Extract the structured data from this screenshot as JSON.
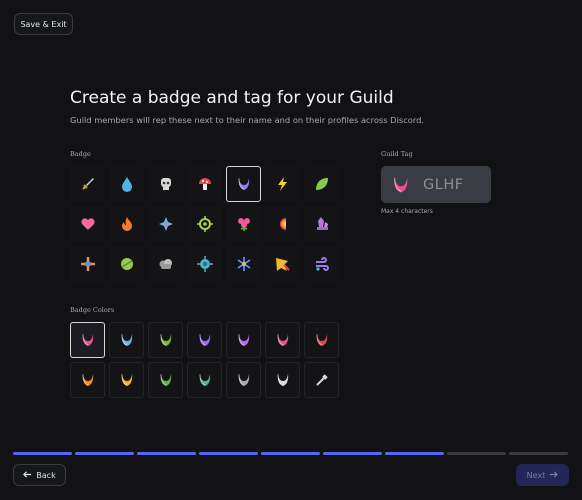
{
  "header": {
    "save_exit_label": "Save & Exit"
  },
  "title": "Create a badge and tag for your Guild",
  "subtitle": "Guild members will rep these next to their name and on their profiles across Discord.",
  "badge_section": {
    "label": "Badge",
    "items": [
      {
        "icon": "sword-icon",
        "color": "#c9a15a"
      },
      {
        "icon": "water-drop-icon",
        "color": "#4fb4e6"
      },
      {
        "icon": "skull-icon",
        "color": "#d8d8d8"
      },
      {
        "icon": "mushroom-icon",
        "color": "#e8484a"
      },
      {
        "icon": "moon-crescent-icon",
        "color": "#8f7bf2",
        "selected": true
      },
      {
        "icon": "lightning-icon",
        "color": "#f3d035"
      },
      {
        "icon": "leaf-icon",
        "color": "#86c94a"
      },
      {
        "icon": "heart-icon",
        "color": "#f06a9a"
      },
      {
        "icon": "fire-icon",
        "color": "#f27a32"
      },
      {
        "icon": "sparkle-icon",
        "color": "#6fb8e8"
      },
      {
        "icon": "target-icon",
        "color": "#a8d04a"
      },
      {
        "icon": "flower-icon",
        "color": "#ef5a9a"
      },
      {
        "icon": "rainbow-icon",
        "color": "#f2a130"
      },
      {
        "icon": "crystal-icon",
        "color": "#b57ad9"
      },
      {
        "icon": "crosshair-icon",
        "color": "#f0922f"
      },
      {
        "icon": "planet-icon",
        "color": "#9cc94a"
      },
      {
        "icon": "cloud-icon",
        "color": "#9a9a9a"
      },
      {
        "icon": "orb-icon",
        "color": "#4fb6c9"
      },
      {
        "icon": "snowflake-icon",
        "color": "#5c8ff0"
      },
      {
        "icon": "comet-icon",
        "color": "#f2b830"
      },
      {
        "icon": "wind-swirl-icon",
        "color": "#9b7af0"
      }
    ]
  },
  "colors_section": {
    "label": "Badge Colors",
    "items": [
      {
        "color": "#ee4f8f",
        "selected": true
      },
      {
        "color": "#6fb4d6"
      },
      {
        "color": "#7bb93f"
      },
      {
        "color": "#9a6cf0"
      },
      {
        "color": "#b46cf0"
      },
      {
        "color": "#e8588e"
      },
      {
        "color": "#d94a5a"
      },
      {
        "color": "#f08a2a"
      },
      {
        "color": "#f0b429"
      },
      {
        "color": "#5fb84a"
      },
      {
        "color": "#4fb88a"
      },
      {
        "color": "#a8a8b0"
      },
      {
        "color": "#d8d8dc"
      },
      {
        "picker": true,
        "color": "#d8d8dc"
      }
    ]
  },
  "tag_section": {
    "label": "Guild Tag",
    "value": "GLHF",
    "hint": "Max 4 characters",
    "badge_color": "#ee4f8f"
  },
  "progress": {
    "total_steps": 9,
    "completed_steps": 7
  },
  "footer": {
    "back_label": "Back",
    "next_label": "Next"
  },
  "accent": "#5865f2"
}
